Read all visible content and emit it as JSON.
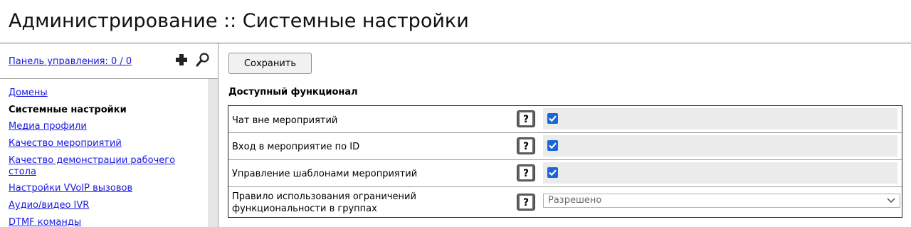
{
  "header": {
    "title": "Администрирование :: Системные настройки"
  },
  "sidebar": {
    "dashboard_link": "Панель управления: 0 / 0",
    "items": [
      {
        "label": "Домены",
        "current": false
      },
      {
        "label": "Системные настройки",
        "current": true
      },
      {
        "label": "Медиа профили",
        "current": false
      },
      {
        "label": "Качество мероприятий",
        "current": false
      },
      {
        "label": "Качество демонстрации рабочего стола",
        "current": false
      },
      {
        "label": "Настройки VVoIP вызовов",
        "current": false
      },
      {
        "label": "Аудио/видео IVR",
        "current": false
      },
      {
        "label": "DTMF команды",
        "current": false
      }
    ]
  },
  "main": {
    "save_label": "Сохранить",
    "section_title": "Доступный функционал",
    "rows": [
      {
        "label": "Чат вне мероприятий",
        "type": "checkbox",
        "checked": true
      },
      {
        "label": "Вход в мероприятие по ID",
        "type": "checkbox",
        "checked": true
      },
      {
        "label": "Управление шаблонами мероприятий",
        "type": "checkbox",
        "checked": true
      },
      {
        "label_line1": "Правило использования ограничений",
        "label_line2": "функциональности в группах",
        "type": "select",
        "value": "Разрешено"
      }
    ]
  },
  "icons": {
    "add": "plus-icon",
    "search": "search-icon",
    "help": "help-icon",
    "checkbox": "checkmark-icon",
    "dropdown": "chevron-down-icon"
  },
  "colors": {
    "link": "#1a1adf",
    "checkbox_accent": "#1a68d8",
    "help_icon_bg": "#5e6266",
    "value_cell_bg": "#ebebeb"
  }
}
